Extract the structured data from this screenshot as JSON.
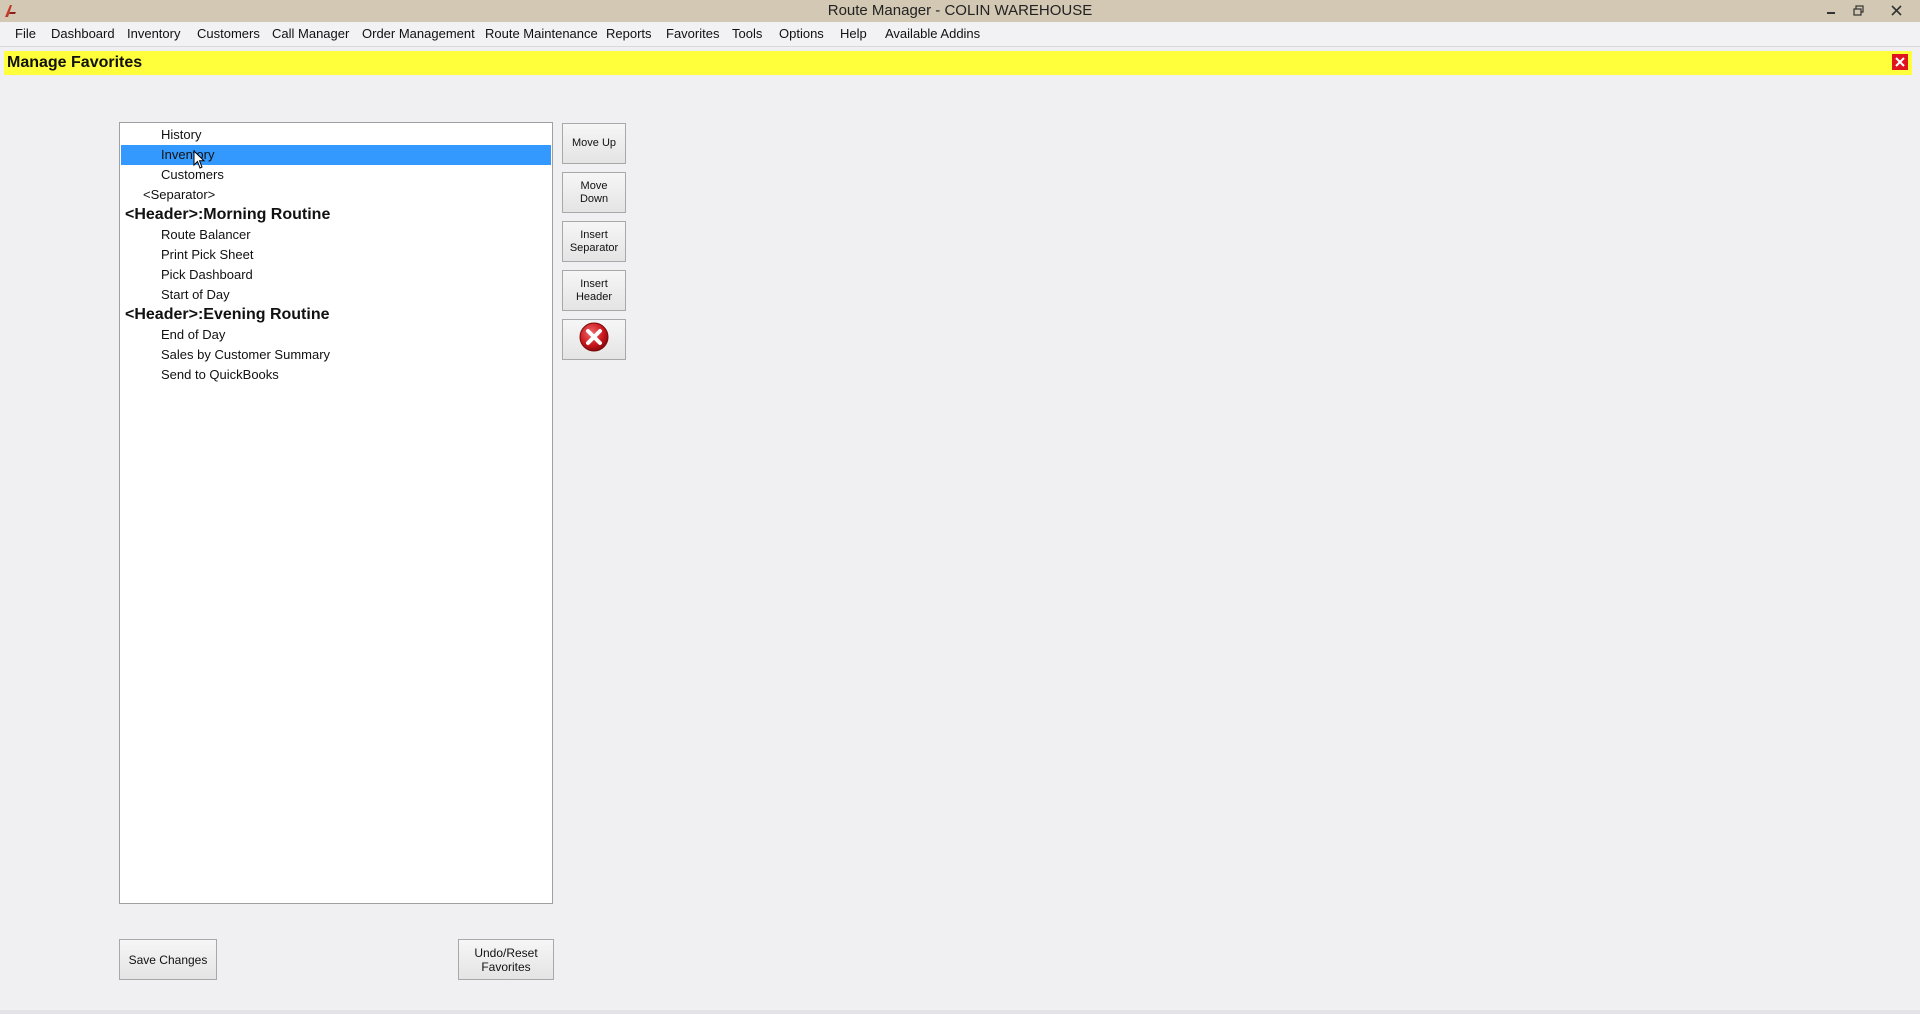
{
  "window": {
    "title": "Route Manager - COLIN WAREHOUSE",
    "icon": "app-logo-icon"
  },
  "menu": [
    "File",
    "Dashboard",
    "Inventory",
    "Customers",
    "Call Manager",
    "Order Management",
    "Route Maintenance",
    "Reports",
    "Favorites",
    "Tools",
    "Options",
    "Help",
    "Available Addins"
  ],
  "form": {
    "title": "Manage Favorites",
    "header_color": "#ffff3c"
  },
  "favorites": [
    {
      "label": "History",
      "kind": "item",
      "selected": false
    },
    {
      "label": "Inventory",
      "kind": "item",
      "selected": true
    },
    {
      "label": "Customers",
      "kind": "item",
      "selected": false
    },
    {
      "label": "<Separator>",
      "kind": "separator",
      "selected": false
    },
    {
      "label": "<Header>:Morning Routine",
      "kind": "header",
      "selected": false
    },
    {
      "label": "Route Balancer",
      "kind": "item",
      "selected": false
    },
    {
      "label": "Print Pick Sheet",
      "kind": "item",
      "selected": false
    },
    {
      "label": "Pick Dashboard",
      "kind": "item",
      "selected": false
    },
    {
      "label": "Start of Day",
      "kind": "item",
      "selected": false
    },
    {
      "label": "<Header>:Evening Routine",
      "kind": "header",
      "selected": false
    },
    {
      "label": "End of Day",
      "kind": "item",
      "selected": false
    },
    {
      "label": "Sales by Customer Summary",
      "kind": "item",
      "selected": false
    },
    {
      "label": "Send to QuickBooks",
      "kind": "item",
      "selected": false
    }
  ],
  "buttons": {
    "move_up": "Move Up",
    "move_down": "Move\nDown",
    "insert_separator": "Insert\nSeparator",
    "insert_header": "Insert\nHeader",
    "delete_icon": "delete-x-icon",
    "save_changes": "Save Changes",
    "undo_reset": "Undo/Reset\nFavorites"
  },
  "colors": {
    "selection": "#3399ff",
    "close_red": "#e0141e"
  }
}
